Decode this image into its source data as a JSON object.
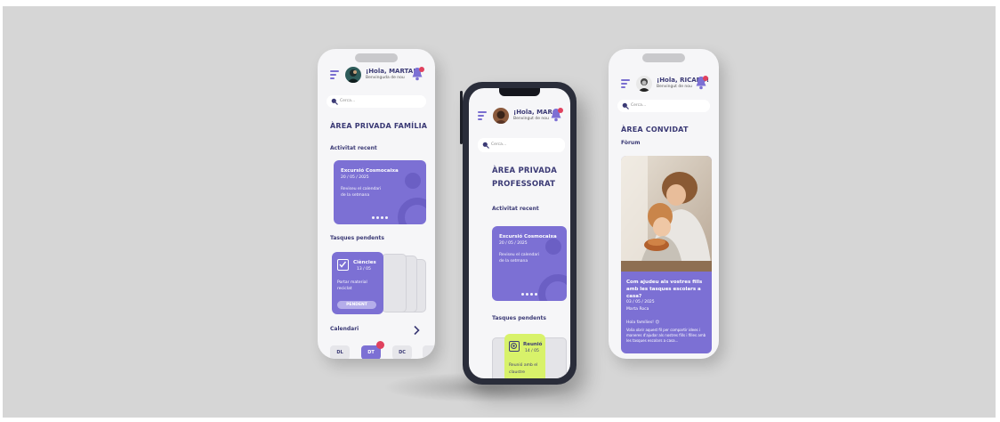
{
  "colors": {
    "background": "#d6d6d6",
    "accent": "#7c70d4",
    "dark_text": "#3b3a75",
    "notification": "#e0415e",
    "highlight": "#d8f26a"
  },
  "icons": [
    "menu-icon",
    "bell-icon",
    "search-icon",
    "checkbox-icon",
    "target-icon",
    "chevron-right-icon"
  ],
  "phone_family": {
    "greeting": "¡Hola, MARTA!",
    "welcome": "Benvinguda de nou",
    "search_placeholder": "Cerca...",
    "section_title": "ÀREA PRIVADA FAMÍLIA",
    "recent_label": "Activitat recent",
    "activity_card": {
      "title": "Excursió Cosmocaixa",
      "date": "20 / 05 / 2025",
      "body": "Reviseu el calendari de la setmana"
    },
    "tasks_label": "Tasques pendents",
    "task_card": {
      "subject": "Ciències",
      "date": "13 / 05",
      "body": "Portar material reciclat",
      "status": "PENDENT"
    },
    "calendar_label": "Calendari",
    "days": [
      "DL",
      "DT",
      "DC"
    ],
    "active_day_index": 1
  },
  "phone_teacher": {
    "greeting": "¡Hola, MARC!",
    "welcome": "Benvingut de nou",
    "search_placeholder": "Cerca...",
    "section_title_line1": "ÀREA PRIVADA",
    "section_title_line2": "PROFESSORAT",
    "recent_label": "Activitat recent",
    "activity_card": {
      "title": "Excursió Cosmocaixa",
      "date": "20 / 05 / 2025",
      "body": "Reviseu el calendari de la setmana"
    },
    "tasks_label": "Tasques pendents",
    "task_card": {
      "subject": "Reunió",
      "date": "14 / 05",
      "body": "Reunió amb el claustre"
    }
  },
  "phone_guest": {
    "greeting": "¡Hola, RICARD!",
    "welcome": "Benvingut de nou",
    "search_placeholder": "Cerca...",
    "section_title": "ÀREA CONVIDAT",
    "forum_label": "Fòrum",
    "post": {
      "title": "Com ajudeu als vostres fills amb les tasques escolars a casa?",
      "date": "03 / 05 / 2025",
      "author": "Marta Roca",
      "greeting": "Hola famílies! 😊",
      "body": "Volia obrir aquest fil per compartir idees i maneres d'ajudar als nostres fills i filles amb les tasques escolars a casa..."
    }
  }
}
